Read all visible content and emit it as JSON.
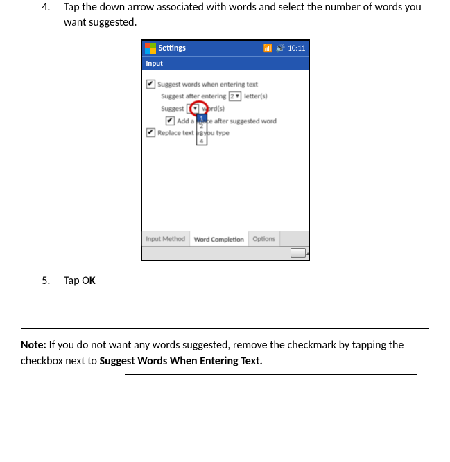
{
  "steps": {
    "four": {
      "num": "4.",
      "text": "Tap the down arrow associated with words and select the number of words you want suggested."
    },
    "five": {
      "num": "5.",
      "prefix": "Tap O",
      "bold": "K"
    }
  },
  "note": {
    "label": "Note:",
    "body": " If you do not want any words suggested, remove the checkmark by tapping the checkbox next to ",
    "bold_tail": "Suggest Words When Entering Text."
  },
  "device": {
    "title": "Settings",
    "time": "10:11",
    "subheader": "Input",
    "row_suggest": "Suggest words when entering text",
    "row_after_prefix": "Suggest after entering",
    "row_after_value": "2",
    "row_after_suffix": "letter(s)",
    "row_words_prefix": "Suggest",
    "row_words_value": "1",
    "row_words_suffix": "word(s)",
    "row_addspace": "Add a space after suggested word",
    "row_replace": "Replace text as you type",
    "dropdown_options": [
      "1",
      "2",
      "3",
      "4"
    ],
    "tabs": {
      "input_method": "Input Method",
      "word_completion": "Word Completion",
      "options": "Options"
    }
  }
}
